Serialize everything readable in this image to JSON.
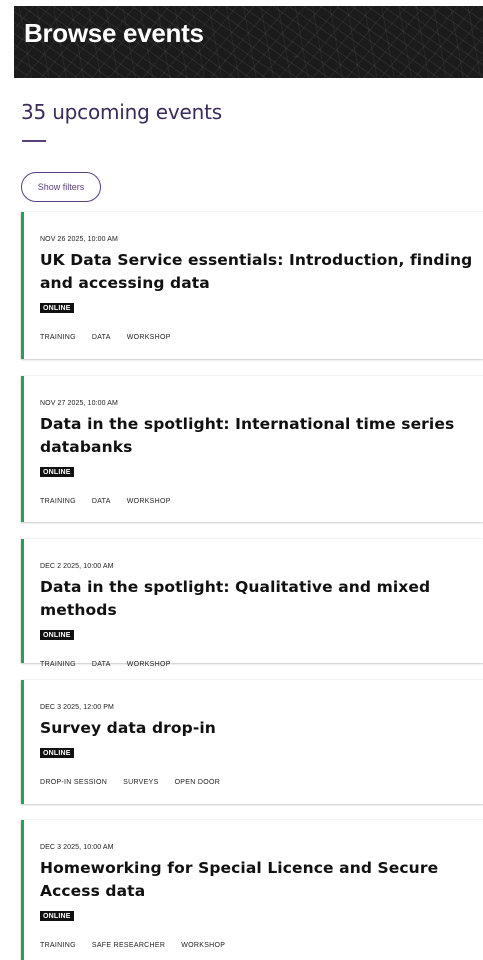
{
  "header": {
    "title": "Browse events"
  },
  "summary": {
    "count_text": "35 upcoming events"
  },
  "filters": {
    "button_label": "Show filters"
  },
  "events": [
    {
      "date": "NOV 26 2025, 10:00 AM",
      "title": "UK Data Service essentials: Introduction, finding and accessing data",
      "badge": "ONLINE",
      "tags": [
        "TRAINING",
        "DATA",
        "WORKSHOP"
      ]
    },
    {
      "date": "NOV 27 2025, 10:00 AM",
      "title": "Data in the spotlight: International time series databanks",
      "badge": "ONLINE",
      "tags": [
        "TRAINING",
        "DATA",
        "WORKSHOP"
      ]
    },
    {
      "date": "DEC 2 2025, 10:00 AM",
      "title": "Data in the spotlight: Qualitative and mixed methods",
      "badge": "ONLINE",
      "tags": [
        "TRAINING",
        "DATA",
        "WORKSHOP"
      ]
    },
    {
      "date": "DEC 3 2025, 12:00 PM",
      "title": "Survey data drop-in",
      "badge": "ONLINE",
      "tags": [
        "DROP-IN SESSION",
        "SURVEYS",
        "OPEN DOOR"
      ]
    },
    {
      "date": "DEC 3 2025, 10:00 AM",
      "title": "Homeworking for Special Licence and Secure Access data",
      "badge": "ONLINE",
      "tags": [
        "TRAINING",
        "SAFE RESEARCHER",
        "WORKSHOP"
      ]
    }
  ],
  "colors": {
    "accent_purple": "#5a3f80",
    "card_border_green": "#2e9d5b",
    "header_bg": "#1b1b1b"
  }
}
